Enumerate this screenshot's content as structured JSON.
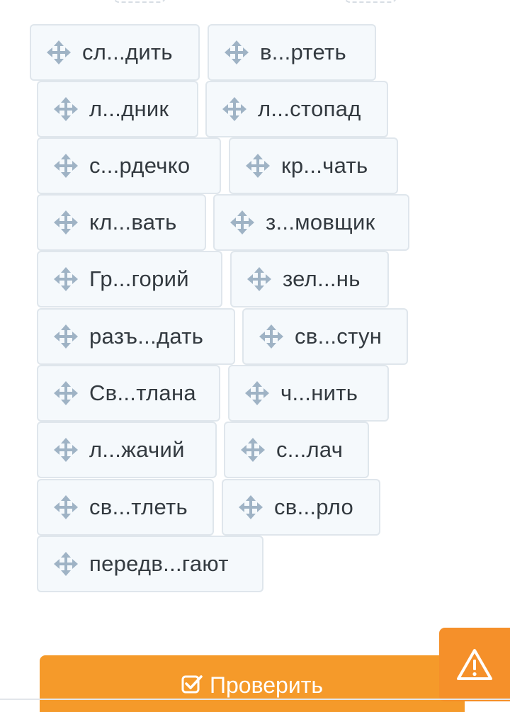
{
  "words": [
    {
      "text": "сл...дить"
    },
    {
      "text": "в...ртеть"
    },
    {
      "text": "л...дник"
    },
    {
      "text": "л...стопад"
    },
    {
      "text": "с...рдечко"
    },
    {
      "text": "кр...чать"
    },
    {
      "text": "кл...вать"
    },
    {
      "text": "з...мовщик"
    },
    {
      "text": "Гр...горий"
    },
    {
      "text": "зел...нь"
    },
    {
      "text": "разъ...дать"
    },
    {
      "text": "св...стун"
    },
    {
      "text": "Св...тлана"
    },
    {
      "text": "ч...нить"
    },
    {
      "text": "л...жачий"
    },
    {
      "text": "с...лач"
    },
    {
      "text": "св...тлеть"
    },
    {
      "text": "св...рло"
    },
    {
      "text": "передв...гают"
    }
  ],
  "check_button": {
    "label": "Проверить",
    "icon": "checkbox-check-icon"
  },
  "warning_button": {
    "icon": "warning-triangle-icon"
  },
  "colors": {
    "chip_bg": "#f5f9fc",
    "chip_border": "#dfe6ec",
    "icon": "#9fb3c5",
    "accent_orange": "#f59a2a"
  }
}
